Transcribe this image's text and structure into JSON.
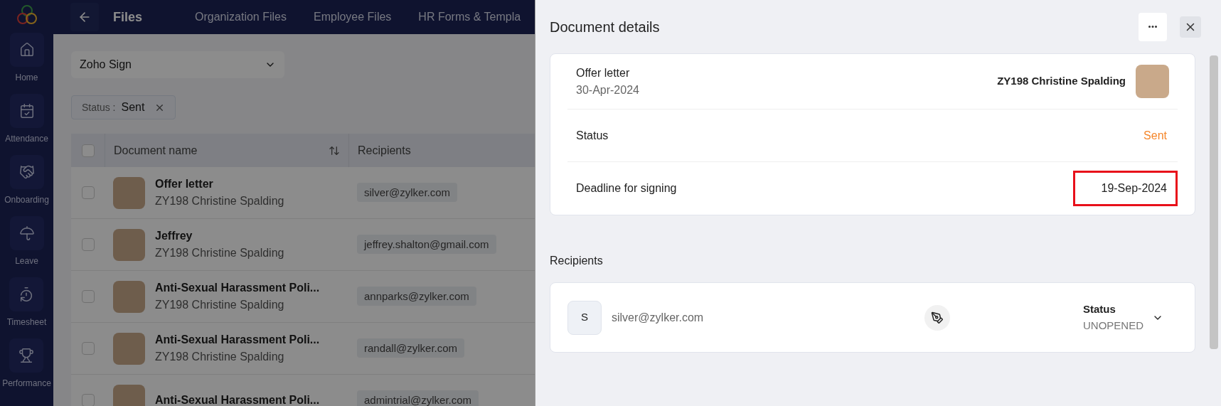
{
  "sidebar": {
    "items": [
      {
        "label": "Home"
      },
      {
        "label": "Attendance"
      },
      {
        "label": "Onboarding"
      },
      {
        "label": "Leave"
      },
      {
        "label": "Timesheet"
      },
      {
        "label": "Performance"
      }
    ]
  },
  "top_bar": {
    "title": "Files",
    "tabs": [
      {
        "label": "Organization Files"
      },
      {
        "label": "Employee Files"
      },
      {
        "label": "HR Forms & Templa"
      }
    ]
  },
  "source_dropdown": {
    "value": "Zoho Sign"
  },
  "filter_chip": {
    "label": "Status :",
    "value": "Sent"
  },
  "table": {
    "all_checked": false,
    "columns": [
      {
        "label": "Document name",
        "sortable": true
      },
      {
        "label": "Recipients",
        "sortable": false
      }
    ],
    "rows": [
      {
        "name": "Offer letter",
        "owner": "ZY198 Christine Spalding",
        "recipient": "silver@zylker.com",
        "checked": false
      },
      {
        "name": "Jeffrey",
        "owner": "ZY198 Christine Spalding",
        "recipient": "jeffrey.shalton@gmail.com",
        "checked": false
      },
      {
        "name": "Anti-Sexual Harassment Poli...",
        "owner": "ZY198 Christine Spalding",
        "recipient": "annparks@zylker.com",
        "checked": false
      },
      {
        "name": "Anti-Sexual Harassment Poli...",
        "owner": "ZY198 Christine Spalding",
        "recipient": "randall@zylker.com",
        "checked": false
      },
      {
        "name": "Anti-Sexual Harassment Poli...",
        "recipient": "admintrial@zylker.com",
        "checked": false
      }
    ]
  },
  "panel": {
    "title": "Document details",
    "document": {
      "name": "Offer letter",
      "date": "30-Apr-2024",
      "owner": "ZY198 Christine Spalding"
    },
    "fields": [
      {
        "label": "Status",
        "value": "Sent",
        "color": "#f5862a",
        "highlighted": false
      },
      {
        "label": "Deadline for signing",
        "value": "19-Sep-2024",
        "color": "#222222",
        "highlighted": true
      }
    ],
    "recipients_heading": "Recipients",
    "recipients": [
      {
        "initial": "S",
        "email": "silver@zylker.com",
        "status_label": "Status",
        "status": "UNOPENED"
      }
    ]
  }
}
